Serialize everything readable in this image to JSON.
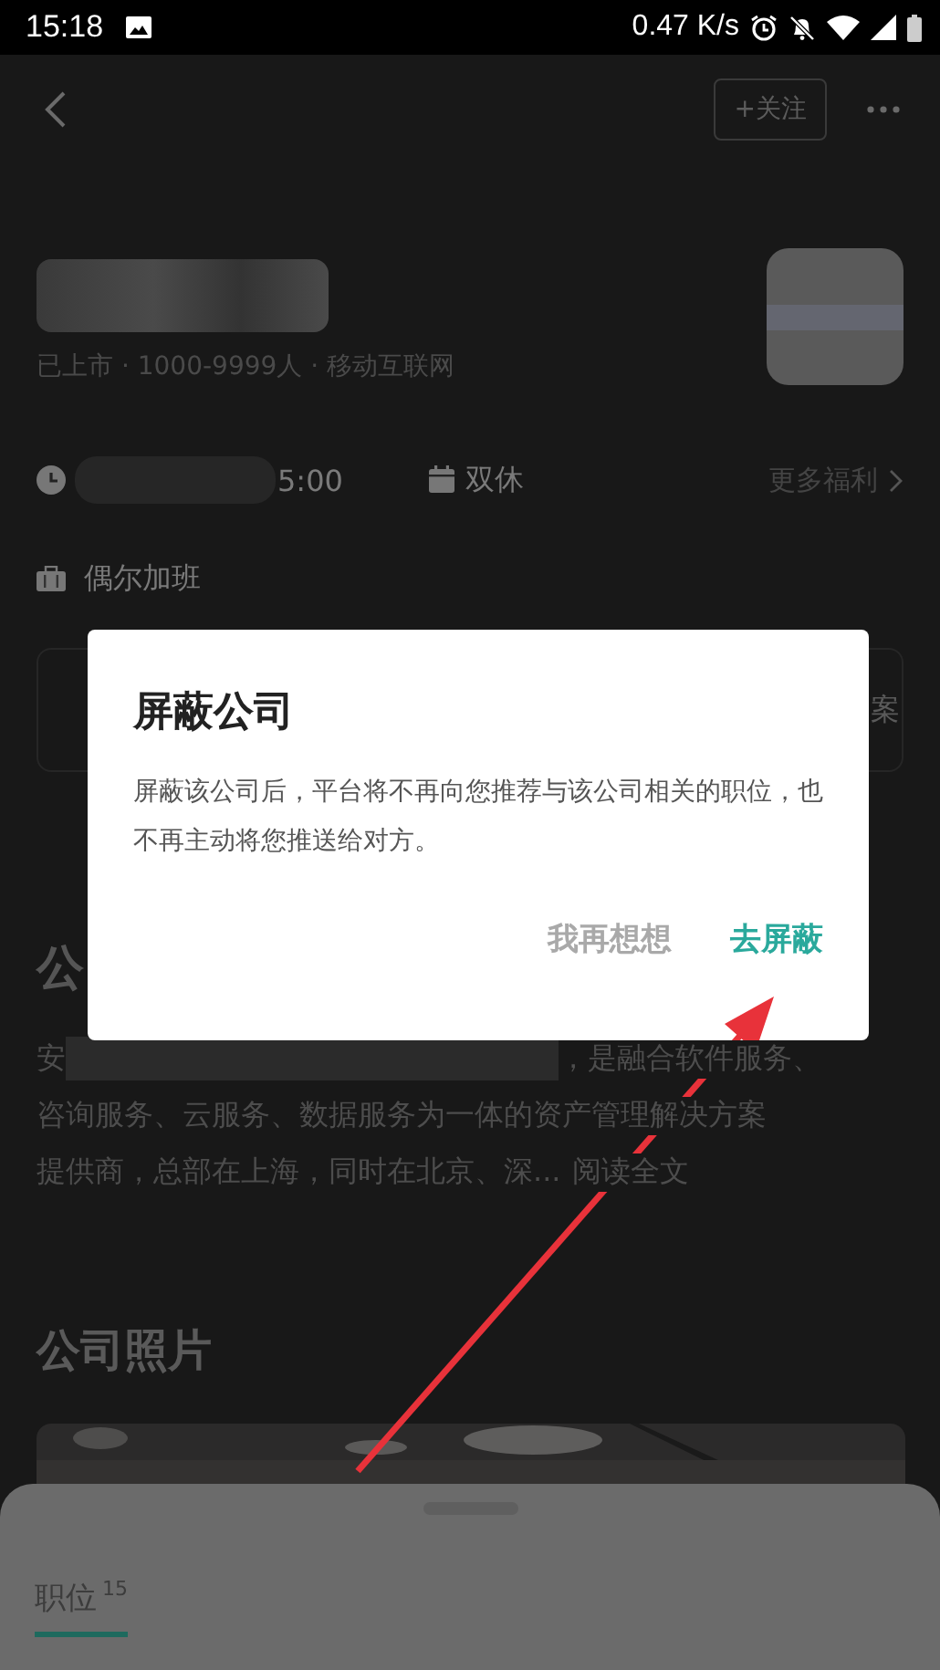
{
  "status_bar": {
    "time": "15:18",
    "net_speed": "0.47 K/s"
  },
  "header": {
    "follow_button": "+关注"
  },
  "company": {
    "meta": "已上市 · 1000-9999人 · 移动互联网"
  },
  "benefits": [
    {
      "kind": "time",
      "text": "5:00"
    },
    {
      "kind": "rest",
      "text": "双休"
    }
  ],
  "more_benefits": "更多福利",
  "overtime": "偶尔加班",
  "card_tail": "案",
  "intro": {
    "heading": "公",
    "lines": [
      {
        "lead": "安",
        "text": "，是融合软件服务、"
      },
      {
        "text": "咨询服务、云服务、数据服务为一体的资产管理解决方案"
      },
      {
        "text": "提供商，总部在上海，同时在北京、深...",
        "link": "阅读全文"
      }
    ]
  },
  "photos": {
    "heading": "公司照片"
  },
  "dialog": {
    "title": "屏蔽公司",
    "message": "屏蔽该公司后，平台将不再向您推荐与该公司相关的职位，也不再主动将您推送给对方。",
    "buttons": [
      {
        "label": "我再想想",
        "kind": "secondary"
      },
      {
        "label": "去屏蔽",
        "kind": "primary"
      }
    ]
  },
  "bottom_tabs": [
    {
      "label": "职位",
      "count": "15",
      "selected": true
    }
  ]
}
